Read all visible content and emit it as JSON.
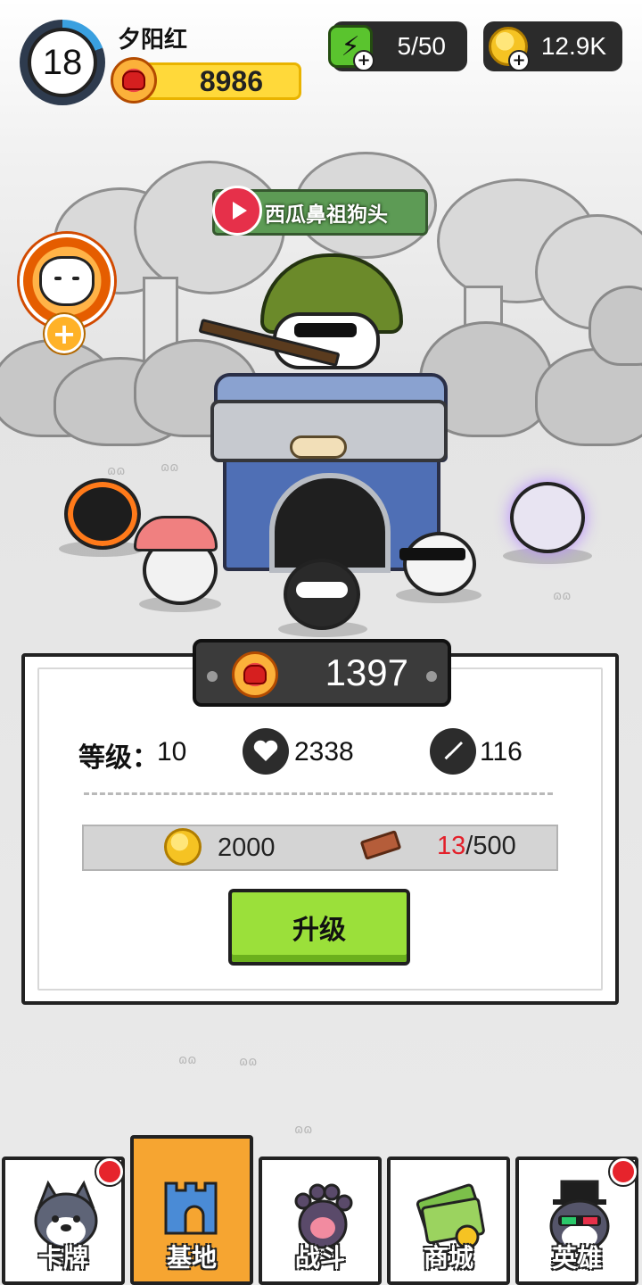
{
  "player": {
    "level": "18",
    "name": "夕阳红",
    "glove_power": "8986"
  },
  "resources": {
    "energy": "5/50",
    "coins": "12.9K"
  },
  "base": {
    "banner_name": "西瓜鼻祖狗头"
  },
  "info_panel": {
    "power": "1397",
    "level_label": "等级：",
    "level_value": "10",
    "hp": "2338",
    "attack": "116",
    "cost_coins": "2000",
    "cost_bricks_have": "13",
    "cost_bricks_need": "/500",
    "upgrade_label": "升级"
  },
  "nav": {
    "tabs": [
      {
        "label": "卡牌",
        "active": false,
        "badge": true
      },
      {
        "label": "基地",
        "active": true,
        "badge": false
      },
      {
        "label": "战斗",
        "active": false,
        "badge": false
      },
      {
        "label": "商城",
        "active": false,
        "badge": false
      },
      {
        "label": "英雄",
        "active": false,
        "badge": true
      }
    ]
  },
  "colors": {
    "accent_orange": "#f6a531",
    "upgrade_green": "#9be03a",
    "brick_count_red": "#e3202a",
    "energy_green": "#5ac42e",
    "coin_gold": "#f5c323"
  },
  "icons": [
    "level-ring",
    "glove-icon",
    "energy-icon",
    "coin-icon",
    "play-icon",
    "lucky-cat-icon",
    "plus-icon",
    "heart-icon",
    "sword-icon",
    "brick-icon",
    "husky-icon",
    "castle-icon",
    "paw-icon",
    "cash-icon",
    "hero-dog-icon"
  ]
}
